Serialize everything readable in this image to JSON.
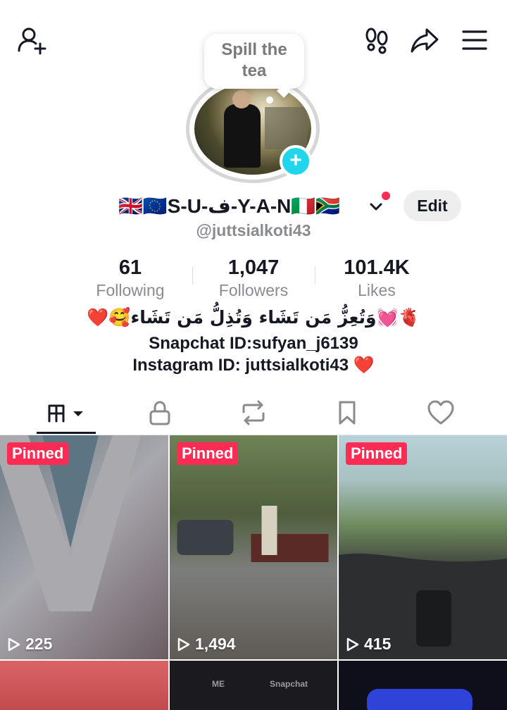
{
  "bubble": {
    "line1": "Spill the",
    "line2": "tea"
  },
  "profile": {
    "display_name": "🇬🇧🇪🇺S-U-ف-Y-A-N🇮🇹🇿🇦",
    "username": "@juttsialkoti43",
    "edit_label": "Edit"
  },
  "stats": [
    {
      "value": "61",
      "label": "Following"
    },
    {
      "value": "1,047",
      "label": "Followers"
    },
    {
      "value": "101.4K",
      "label": "Likes"
    }
  ],
  "bio": {
    "line1": "❤️🥰وَتُعِزُّ مَن تَشَاء وَتُذِلُّ مَن تَشَاء💓🫀",
    "line2": "Snapchat ID:sufyan_j6139",
    "line3": "Instagram ID: juttsialkoti43 ❤️"
  },
  "videos": [
    {
      "pinned": "Pinned",
      "views": "225"
    },
    {
      "pinned": "Pinned",
      "views": "1,494"
    },
    {
      "pinned": "Pinned",
      "views": "415"
    }
  ],
  "partial_tiles": {
    "t5_left": "ME",
    "t5_right": "Snapchat"
  },
  "colors": {
    "accent": "#fe2c55",
    "plus": "#20d5ec",
    "secondary_text": "#8a8b91"
  },
  "icons": [
    "add-friend-icon",
    "footprints-icon",
    "share-icon",
    "menu-icon",
    "videos-grid-icon",
    "lock-icon",
    "repost-icon",
    "bookmark-icon",
    "heart-icon",
    "play-icon"
  ]
}
